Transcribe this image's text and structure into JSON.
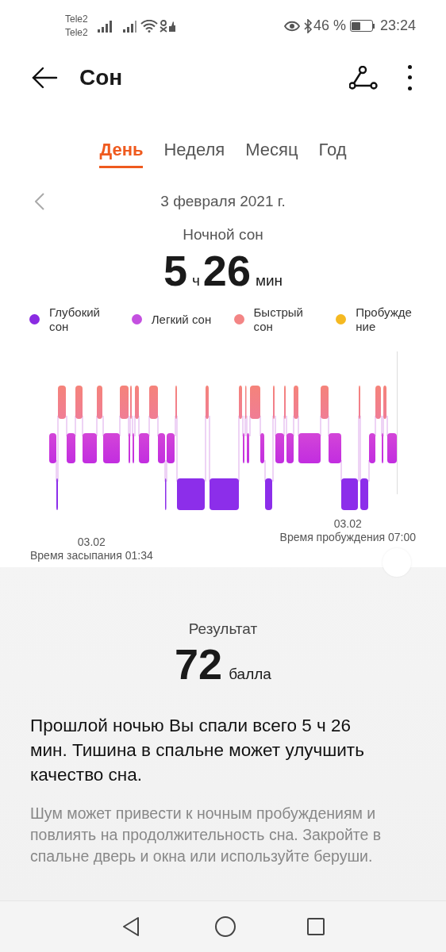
{
  "status_bar": {
    "carriers": [
      "Tele2",
      "Tele2"
    ],
    "battery": "46 %",
    "time": "23:24"
  },
  "header": {
    "title": "Сон"
  },
  "tabs": [
    {
      "label": "День",
      "selected": true
    },
    {
      "label": "Неделя",
      "selected": false
    },
    {
      "label": "Месяц",
      "selected": false
    },
    {
      "label": "Год",
      "selected": false
    }
  ],
  "date": "3 февраля 2021 г.",
  "summary": {
    "label": "Ночной сон",
    "hours": "5",
    "hours_unit": "ч",
    "minutes": "26",
    "minutes_unit": "мин"
  },
  "legend": [
    {
      "lines": [
        "Глубокий",
        "сон"
      ],
      "color": "#8a2be2"
    },
    {
      "lines": [
        "Легкий сон"
      ],
      "color": "#c450e0"
    },
    {
      "lines": [
        "Быстрый",
        "сон"
      ],
      "color": "#f38585"
    },
    {
      "lines": [
        "Пробужде",
        "ние"
      ],
      "color": "#f5b921"
    }
  ],
  "sleep_start": {
    "date": "03.02",
    "label": "Время засыпания 01:34"
  },
  "wake_up": {
    "date": "03.02",
    "label": "Время пробуждения 07:00"
  },
  "result": {
    "label": "Результат",
    "score": "72",
    "unit": "балла"
  },
  "advice": {
    "headline": "Прошлой ночью Вы спали всего 5 ч 26 мин. Тишина в спальне может улучшить качество сна.",
    "body": "Шум может привести к ночным пробуждениям и повлиять на продолжительность сна. Закройте в спальне дверь и окна или используйте беруши."
  }
}
